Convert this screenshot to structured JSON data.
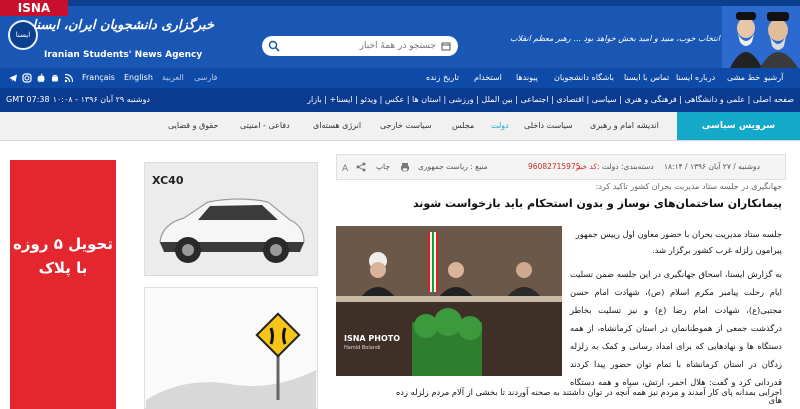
{
  "header": {
    "badge": "ISNA",
    "logo_label": "ایسنا",
    "title_fa": "خبرگزاری دانشجویان ایران، ایسنا",
    "title_en": "Iranian Students' News Agency",
    "search_placeholder": "جستجو در همهٔ اخبار",
    "quote": "انتخاب خوب، منید و امید بخش خواهد بود ... رهبر معظم انقلاب"
  },
  "nav1": {
    "links_right": [
      "آرشیو",
      "خط مشی",
      "درباره ایسنا",
      "تماس با ایسنا",
      "باشگاه دانشجویان",
      "پیوندها",
      "استخدام",
      "تاریخ زنده"
    ],
    "languages": [
      "Français",
      "English",
      "العربية",
      "فارسی"
    ],
    "icons": [
      "telegram-icon",
      "instagram-icon",
      "apple-icon",
      "android-icon",
      "rss-icon"
    ]
  },
  "nav2": {
    "time": "GMT 07:38",
    "date": "دوشنبه ۲۹ آبان ۱۳۹۶ - ۱۰:۰۸",
    "categories": "صفحه اصلی | علمی و دانشگاهی | فرهنگی و هنری | سیاسی | اقتصادی | اجتماعی | بین الملل | ورزشی | استان ها | عکس | ویدئو | ایسنا+ | بازار"
  },
  "services": {
    "title": "سرویس سیاسی",
    "items": [
      "اندیشه امام و رهبری",
      "سیاست داخلی",
      "دولت",
      "مجلس",
      "سیاست خارجی",
      "انرژی هسته‌ای",
      "دفاعی - امنیتی",
      "حقوق و قضایی"
    ],
    "active_index": 2,
    "active_color": "#14a9c8"
  },
  "ads": {
    "red_text": "تحویل ۵ روزه با پلاک",
    "car_label": "XC40"
  },
  "article": {
    "meta_date": "دوشنبه / ۲۷ آبان ۱۳۹۶ / ۱۸:۱۴",
    "meta_section": "دسته‌بندی: دولت",
    "meta_code_label": "کد خبر:",
    "meta_code": "96082715975",
    "meta_source": "منبع : ریاست جمهوری",
    "meta_print": "چاپ",
    "kicker": "جهانگیری در جلسه ستاد مدیریت بحران کشور تاکید کرد:",
    "headline": "پیمانکاران ساختمان‌های نوساز و بدون استحکام باید بازخواست شوند",
    "photo_credit": "ISNA PHOTO",
    "photo_credit_sub": "Hamid Bolandi",
    "lead": "جلسه ستاد مدیریت بحران با حضور معاون اول رییس جمهور پیرامون زلزله غرب کشور برگزار شد.",
    "body": "به گزارش ایسنا، اسحاق جهانگیری در این جلسه ضمن تسلیت ایام رحلت پیامبر مکرم اسلام (ص)، شهادت امام حسن مجتبی(ع)، شهادت امام رضا (ع) و نیز تسلیت بخاطر درگذشت جمعی از هموطنانمان در استان کرمانشاه، از همه دستگاه ها و نهادهایی که برای امداد رسانی و کمک به زلزله زدگان در استان کرمانشاه با تمام توان حضور پیدا کردند قدردانی کرد و گفت: هلال احمر، ارتش، سپاه و همه دستگاه های",
    "body_last": "اجرایی بمدانه پای کار آمدند و مردم نیز همه آنچه در توان داشتند به صحنه آوردند تا بخشی از آلام مردم زلزله زده"
  }
}
